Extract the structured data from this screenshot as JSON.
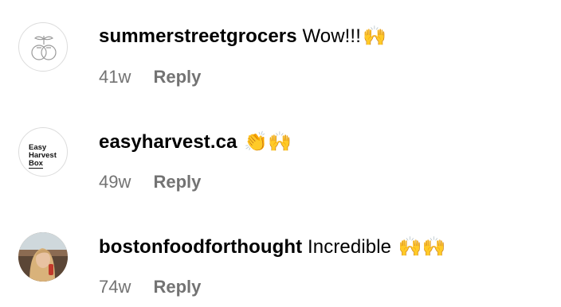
{
  "comments": [
    {
      "username": "summerstreetgrocers",
      "text": "Wow!!!",
      "emoji": "🙌",
      "time": "41w",
      "reply_label": "Reply"
    },
    {
      "username": "easyharvest.ca",
      "text": "",
      "emoji": "👏🙌",
      "time": "49w",
      "reply_label": "Reply",
      "logo": {
        "line1": "Easy",
        "line2": "Harvest",
        "line3": "Box"
      }
    },
    {
      "username": "bostonfoodforthought",
      "text": "Incredible",
      "emoji": "🙌🙌",
      "time": "74w",
      "reply_label": "Reply"
    }
  ]
}
